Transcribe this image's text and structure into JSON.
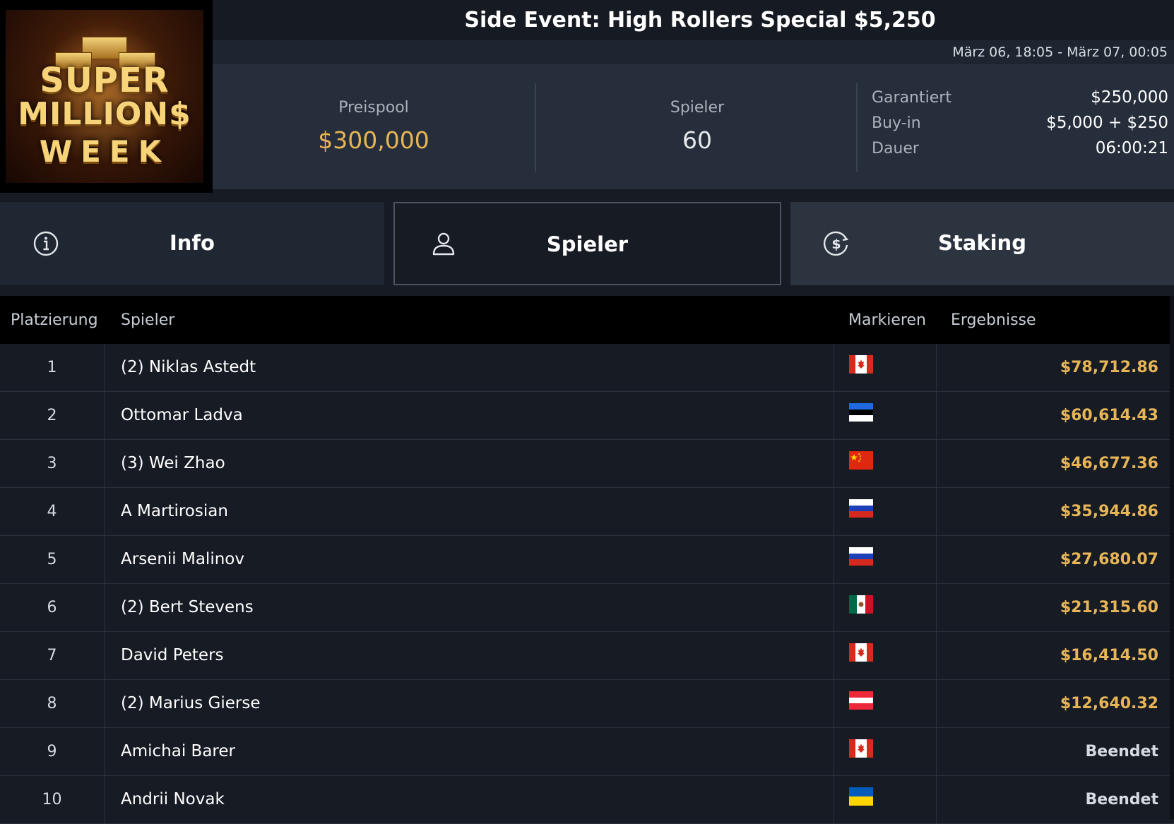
{
  "header": {
    "title": "Side Event: High Rollers Special $5,250",
    "dates": "März 06, 18:05 - März 07, 00:05"
  },
  "logo": {
    "line1": "SUPER",
    "line2": "MILLION$",
    "line3": "WEEK"
  },
  "stats": {
    "prizepool_label": "Preispool",
    "prizepool_value": "$300,000",
    "players_label": "Spieler",
    "players_value": "60",
    "details": [
      {
        "label": "Garantiert",
        "value": "$250,000"
      },
      {
        "label": "Buy-in",
        "value": "$5,000 + $250"
      },
      {
        "label": "Dauer",
        "value": "06:00:21"
      }
    ]
  },
  "tabs": {
    "info": "Info",
    "spieler": "Spieler",
    "staking": "Staking"
  },
  "table": {
    "headers": {
      "place": "Platzierung",
      "player": "Spieler",
      "mark": "Markieren",
      "result": "Ergebnisse"
    },
    "rows": [
      {
        "place": "1",
        "player": "(2) Niklas Astedt",
        "flag": "canada",
        "result": "$78,712.86",
        "money": true
      },
      {
        "place": "2",
        "player": "Ottomar Ladva",
        "flag": "estonia",
        "result": "$60,614.43",
        "money": true
      },
      {
        "place": "3",
        "player": "(3) Wei Zhao",
        "flag": "china",
        "result": "$46,677.36",
        "money": true
      },
      {
        "place": "4",
        "player": "A Martirosian",
        "flag": "russia",
        "result": "$35,944.86",
        "money": true
      },
      {
        "place": "5",
        "player": "Arsenii Malinov",
        "flag": "russia",
        "result": "$27,680.07",
        "money": true
      },
      {
        "place": "6",
        "player": "(2) Bert Stevens",
        "flag": "mexico",
        "result": "$21,315.60",
        "money": true
      },
      {
        "place": "7",
        "player": "David Peters",
        "flag": "canada",
        "result": "$16,414.50",
        "money": true
      },
      {
        "place": "8",
        "player": "(2) Marius Gierse",
        "flag": "austria",
        "result": "$12,640.32",
        "money": true
      },
      {
        "place": "9",
        "player": "Amichai Barer",
        "flag": "canada",
        "result": "Beendet",
        "money": false
      },
      {
        "place": "10",
        "player": "Andrii Novak",
        "flag": "ukraine",
        "result": "Beendet",
        "money": false
      }
    ]
  },
  "colors": {
    "gold": "#e8b556",
    "background": "#161b24"
  },
  "icons": {
    "info_tab": "info-circle-icon",
    "spieler_tab": "person-icon",
    "staking_tab": "dollar-coin-icon"
  }
}
